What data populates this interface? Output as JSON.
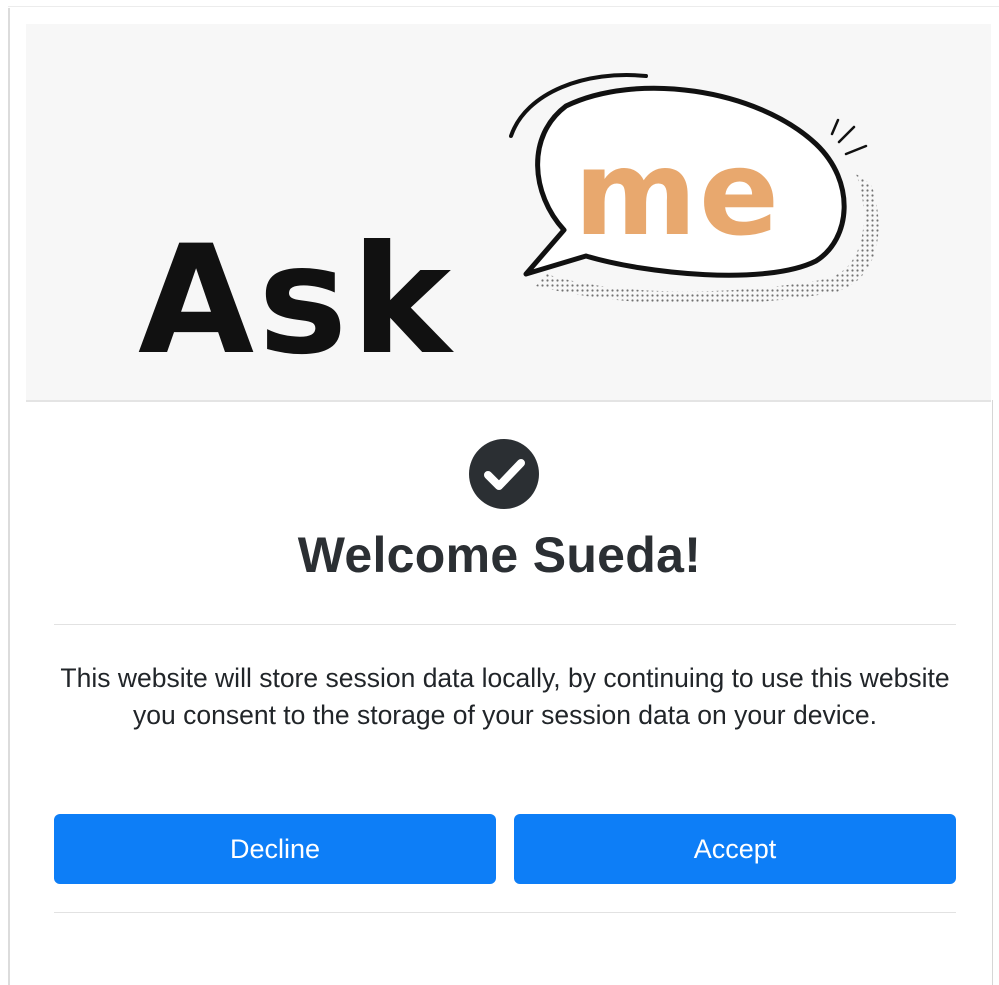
{
  "banner": {
    "logo_word": "Ask",
    "logo_bubble_word": "me",
    "logo_colors": {
      "word": "#111111",
      "bubble_text": "#e8a86e",
      "bubble_outline": "#111111"
    }
  },
  "dialog": {
    "status_icon": "check-circle-icon",
    "title": "Welcome Sueda!",
    "message": "This website will store session data locally, by continuing to use this website you consent to the storage of your session data on your device.",
    "decline_label": "Decline",
    "accept_label": "Accept"
  },
  "colors": {
    "accent": "#0d7ef7",
    "text": "#212529",
    "check_circle": "#2b2f33"
  }
}
